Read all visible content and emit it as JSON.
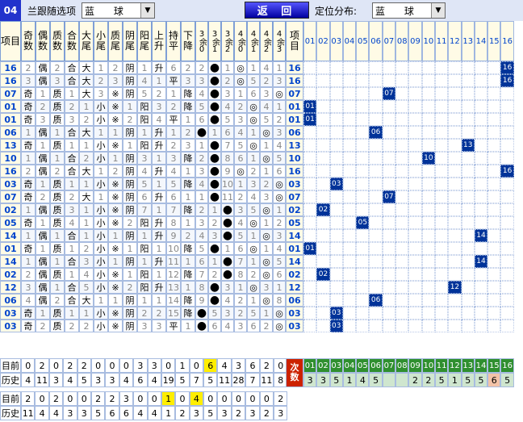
{
  "toolbar": {
    "corner": "04",
    "follow_label": "兰跟随选项",
    "follow_value": "蓝 球",
    "back_label": "返 回",
    "pos_label": "定位分布:",
    "pos_value": "蓝 球"
  },
  "left_headers": [
    "项目",
    "奇数",
    "偶数",
    "质数",
    "合数",
    "大尾",
    "小尾",
    "质尾",
    "阴尾",
    "阳尾",
    "上升",
    "持平",
    "下降",
    "3余0",
    "3余1",
    "3余2",
    "4余0",
    "4余1",
    "4余2",
    "4余3",
    "项目"
  ],
  "right_headers": [
    "01",
    "02",
    "03",
    "04",
    "05",
    "06",
    "07",
    "08",
    "09",
    "10",
    "11",
    "12",
    "13",
    "14",
    "15",
    "16"
  ],
  "rows": [
    {
      "id": "16",
      "cells": [
        "2",
        "偶",
        "2",
        "合",
        "大",
        "1",
        "2",
        "阴",
        "1",
        "升",
        "6",
        "2",
        "2",
        "●",
        "1",
        "◎",
        "1",
        "4",
        "1"
      ],
      "hit": 16
    },
    {
      "id": "16",
      "cells": [
        "3",
        "偶",
        "3",
        "合",
        "大",
        "2",
        "3",
        "阴",
        "4",
        "1",
        "平",
        "3",
        "3",
        "●",
        "2",
        "◎",
        "5",
        "2",
        "3"
      ],
      "hit": 16
    },
    {
      "id": "07",
      "cells": [
        "奇",
        "1",
        "质",
        "1",
        "大",
        "3",
        "※",
        "阴",
        "5",
        "2",
        "1",
        "降",
        "4",
        "●",
        "3",
        "1",
        "6",
        "3",
        "◎"
      ],
      "hit": 7
    },
    {
      "id": "01",
      "cells": [
        "奇",
        "2",
        "质",
        "2",
        "1",
        "小",
        "※",
        "1",
        "阳",
        "3",
        "2",
        "降",
        "5",
        "●",
        "4",
        "2",
        "◎",
        "4",
        "1"
      ],
      "hit": 1
    },
    {
      "id": "01",
      "cells": [
        "奇",
        "3",
        "质",
        "3",
        "2",
        "小",
        "※",
        "2",
        "阳",
        "4",
        "平",
        "1",
        "6",
        "●",
        "5",
        "3",
        "◎",
        "5",
        "2"
      ],
      "hit": 1
    },
    {
      "id": "06",
      "cells": [
        "1",
        "偶",
        "1",
        "合",
        "大",
        "1",
        "1",
        "阴",
        "1",
        "升",
        "1",
        "2",
        "●",
        "1",
        "6",
        "4",
        "1",
        "◎",
        "3"
      ],
      "hit": 6
    },
    {
      "id": "13",
      "cells": [
        "奇",
        "1",
        "质",
        "1",
        "1",
        "小",
        "※",
        "1",
        "阳",
        "升",
        "2",
        "3",
        "1",
        "●",
        "7",
        "5",
        "◎",
        "1",
        "4"
      ],
      "hit": 13
    },
    {
      "id": "10",
      "cells": [
        "1",
        "偶",
        "1",
        "合",
        "2",
        "小",
        "1",
        "阴",
        "3",
        "1",
        "3",
        "降",
        "2",
        "●",
        "8",
        "6",
        "1",
        "◎",
        "5"
      ],
      "hit": 10
    },
    {
      "id": "16",
      "cells": [
        "2",
        "偶",
        "2",
        "合",
        "大",
        "1",
        "2",
        "阴",
        "4",
        "升",
        "4",
        "1",
        "3",
        "●",
        "9",
        "◎",
        "2",
        "1",
        "6"
      ],
      "hit": 16
    },
    {
      "id": "03",
      "cells": [
        "奇",
        "1",
        "质",
        "1",
        "1",
        "小",
        "※",
        "阴",
        "5",
        "1",
        "5",
        "降",
        "4",
        "●",
        "10",
        "1",
        "3",
        "2",
        "◎"
      ],
      "hit": 3
    },
    {
      "id": "07",
      "cells": [
        "奇",
        "2",
        "质",
        "2",
        "大",
        "1",
        "※",
        "阴",
        "6",
        "升",
        "6",
        "1",
        "1",
        "●",
        "11",
        "2",
        "4",
        "3",
        "◎"
      ],
      "hit": 7
    },
    {
      "id": "02",
      "cells": [
        "1",
        "偶",
        "质",
        "3",
        "1",
        "小",
        "※",
        "阴",
        "7",
        "1",
        "7",
        "降",
        "2",
        "1",
        "●",
        "3",
        "5",
        "◎",
        "1"
      ],
      "hit": 2
    },
    {
      "id": "05",
      "cells": [
        "奇",
        "1",
        "质",
        "4",
        "1",
        "小",
        "※",
        "2",
        "阳",
        "升",
        "8",
        "1",
        "3",
        "2",
        "●",
        "4",
        "◎",
        "1",
        "2"
      ],
      "hit": 5
    },
    {
      "id": "14",
      "cells": [
        "1",
        "偶",
        "1",
        "合",
        "1",
        "小",
        "1",
        "阴",
        "1",
        "升",
        "9",
        "2",
        "4",
        "3",
        "●",
        "5",
        "1",
        "◎",
        "3"
      ],
      "hit": 14
    },
    {
      "id": "01",
      "cells": [
        "奇",
        "1",
        "质",
        "1",
        "2",
        "小",
        "※",
        "1",
        "阳",
        "1",
        "10",
        "降",
        "5",
        "●",
        "1",
        "6",
        "◎",
        "1",
        "4"
      ],
      "hit": 1
    },
    {
      "id": "14",
      "cells": [
        "1",
        "偶",
        "1",
        "合",
        "3",
        "小",
        "1",
        "阴",
        "1",
        "升",
        "11",
        "1",
        "6",
        "1",
        "●",
        "7",
        "1",
        "◎",
        "5"
      ],
      "hit": 14
    },
    {
      "id": "02",
      "cells": [
        "2",
        "偶",
        "质",
        "1",
        "4",
        "小",
        "※",
        "1",
        "阳",
        "1",
        "12",
        "降",
        "7",
        "2",
        "●",
        "8",
        "2",
        "◎",
        "6"
      ],
      "hit": 2
    },
    {
      "id": "12",
      "cells": [
        "3",
        "偶",
        "1",
        "合",
        "5",
        "小",
        "※",
        "2",
        "阳",
        "升",
        "13",
        "1",
        "8",
        "●",
        "3",
        "1",
        "◎",
        "3",
        "1"
      ],
      "hit": 12
    },
    {
      "id": "06",
      "cells": [
        "4",
        "偶",
        "2",
        "合",
        "大",
        "1",
        "1",
        "阴",
        "1",
        "1",
        "14",
        "降",
        "9",
        "●",
        "4",
        "2",
        "1",
        "◎",
        "8"
      ],
      "hit": 6
    },
    {
      "id": "03",
      "cells": [
        "奇",
        "1",
        "质",
        "1",
        "1",
        "小",
        "※",
        "阴",
        "2",
        "2",
        "15",
        "降",
        "●",
        "5",
        "3",
        "2",
        "5",
        "1",
        "◎"
      ],
      "hit": 3
    },
    {
      "id": "03",
      "cells": [
        "奇",
        "2",
        "质",
        "2",
        "2",
        "小",
        "※",
        "阴",
        "3",
        "3",
        "平",
        "1",
        "●",
        "6",
        "4",
        "3",
        "6",
        "2",
        "◎"
      ],
      "hit": 3
    }
  ],
  "stats": {
    "current_label": "目前",
    "history_label": "历史",
    "next_label": "次数",
    "current": [
      "0",
      "2",
      "0",
      "2",
      "2",
      "0",
      "0",
      "0",
      "3",
      "3",
      "0",
      "1",
      "0",
      "6",
      "4",
      "3",
      "6",
      "2",
      "0"
    ],
    "history": [
      "4",
      "11",
      "3",
      "4",
      "5",
      "3",
      "3",
      "4",
      "6",
      "4",
      "19",
      "5",
      "7",
      "5",
      "11",
      "28",
      "7",
      "11",
      "8"
    ],
    "highlight_current_index": 13,
    "dist_headers": [
      "01",
      "02",
      "03",
      "04",
      "05",
      "06",
      "07",
      "08",
      "09",
      "10",
      "11",
      "12",
      "13",
      "14",
      "15",
      "16"
    ],
    "dist_values": [
      "3",
      "3",
      "5",
      "1",
      "4",
      "5",
      "",
      "",
      "2",
      "2",
      "5",
      "1",
      "5",
      "5",
      "6",
      "5"
    ],
    "current2": [
      "2",
      "0",
      "2",
      "0",
      "0",
      "2",
      "2",
      "3",
      "0",
      "0",
      "1",
      "0",
      "4",
      "0",
      "0",
      "0",
      "0",
      "0",
      "2"
    ],
    "history2": [
      "11",
      "4",
      "4",
      "3",
      "3",
      "5",
      "6",
      "6",
      "4",
      "4",
      "1",
      "2",
      "3",
      "5",
      "3",
      "2",
      "3",
      "2",
      "3"
    ],
    "highlight2": [
      10,
      12
    ]
  }
}
